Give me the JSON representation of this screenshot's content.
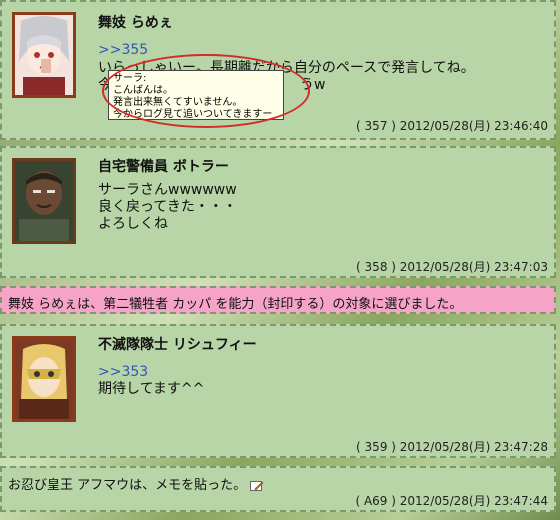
{
  "posts": [
    {
      "name": "舞妓 らめぇ",
      "reply": ">>355",
      "text": "いらっしゃいー。長期離だから自分のペースで発言してね。\n今から...",
      "text_tail": "うw",
      "meta": "( 357 ) 2012/05/28(月) 23:46:40"
    },
    {
      "name": "自宅警備員 ボトラー",
      "text": "サーラさんwwwwww\n良く戻ってきた・・・\nよろしくね",
      "meta": "( 358 ) 2012/05/28(月) 23:47:03"
    },
    {
      "name": "不滅隊隊士 リシュフィー",
      "reply": ">>353",
      "text": "期待してます^^",
      "meta": "( 359 ) 2012/05/28(月) 23:47:28"
    }
  ],
  "tooltip": "サーラ:\nこんばんは。\n発言出来無くてすいません。\n今からログ見て追いついてきますー",
  "system_notice": "舞妓 らめぇは、第二犠牲者 カッパ を能力（封印する）の対象に選びました。",
  "memo": {
    "text": "お忍び皇王 アフマウは、メモを貼った。",
    "meta": "( A69 ) 2012/05/28(月) 23:47:44"
  }
}
